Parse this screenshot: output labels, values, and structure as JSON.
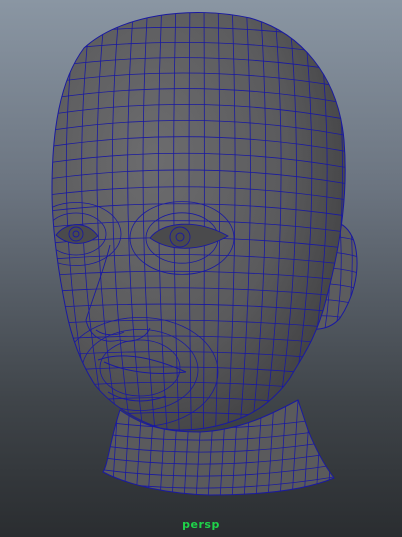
{
  "viewport": {
    "camera_name": "persp",
    "background_top": "#8a96a3",
    "background_bottom": "#2a2d30",
    "wireframe_color": "#1a1aa0",
    "mesh_fill_color": "#5e5e60"
  }
}
